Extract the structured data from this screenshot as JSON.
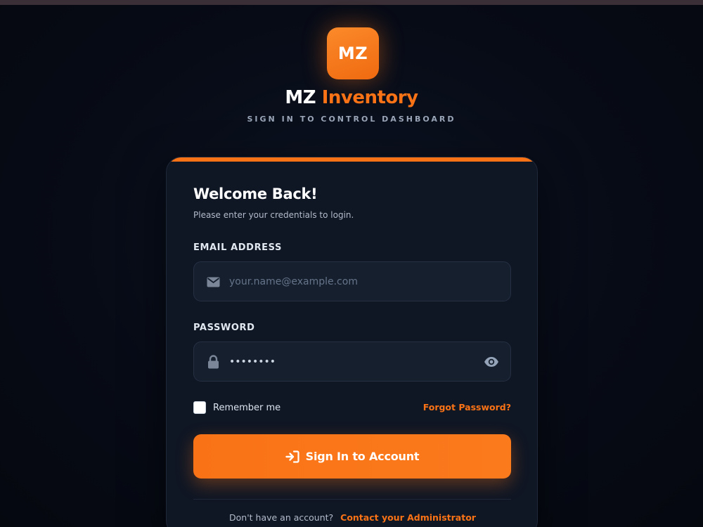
{
  "app": {
    "logo_text": "MZ",
    "brand_part1": "MZ",
    "brand_part2": "Inventory",
    "tagline": "SIGN IN TO CONTROL DASHBOARD"
  },
  "colors": {
    "accent": "#f97316",
    "background": "#070b16",
    "card": "#0f1624",
    "field": "#151f2e"
  },
  "login": {
    "title": "Welcome Back!",
    "subtitle": "Please enter your credentials to login.",
    "email": {
      "label": "EMAIL ADDRESS",
      "placeholder": "your.name@example.com",
      "value": "",
      "icon": "envelope-icon"
    },
    "password": {
      "label": "PASSWORD",
      "value": "••••••••",
      "icon": "lock-icon",
      "toggle_icon": "eye-icon"
    },
    "remember_label": "Remember me",
    "remember_checked": false,
    "forgot_label": "Forgot Password?",
    "submit_label": "Sign In to Account",
    "submit_icon": "sign-in-icon",
    "footer_text": "Don't have an account?",
    "footer_link": "Contact your Administrator"
  }
}
